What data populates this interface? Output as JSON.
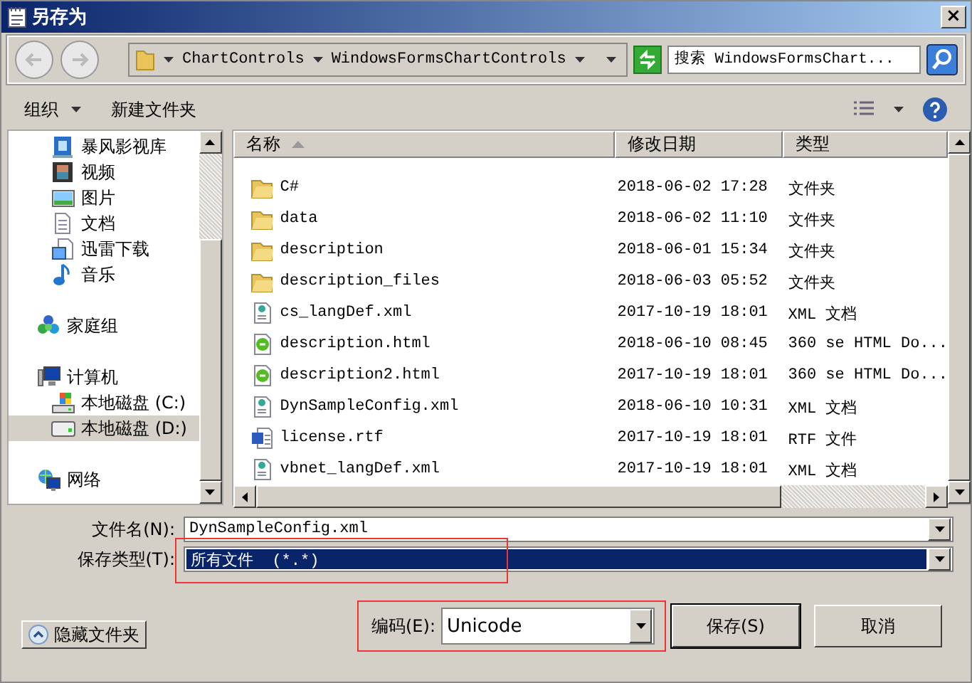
{
  "window": {
    "title": "另存为",
    "close": "×"
  },
  "address": {
    "crumbs": [
      "ChartControls",
      "WindowsFormsChartControls"
    ],
    "search_placeholder": "搜索 WindowsFormsChart..."
  },
  "toolbar": {
    "organize": "组织",
    "new_folder": "新建文件夹"
  },
  "sidebar": {
    "library_items": [
      {
        "kind": "library",
        "label": "暴风影视库",
        "selected": false
      },
      {
        "kind": "video",
        "label": "视频",
        "selected": false
      },
      {
        "kind": "picture",
        "label": "图片",
        "selected": false
      },
      {
        "kind": "doc",
        "label": "文档",
        "selected": false
      },
      {
        "kind": "download",
        "label": "迅雷下载",
        "selected": false
      },
      {
        "kind": "music",
        "label": "音乐",
        "selected": false
      }
    ],
    "items": [
      {
        "kind": "homegroup",
        "label": "家庭组",
        "selected": false
      },
      {
        "kind": "computer",
        "label": "计算机",
        "selected": false,
        "children": [
          {
            "kind": "sysdrive",
            "label": "本地磁盘 (C:)",
            "selected": false
          },
          {
            "kind": "drive",
            "label": "本地磁盘 (D:)",
            "selected": true
          }
        ]
      },
      {
        "kind": "network",
        "label": "网络",
        "selected": false
      }
    ]
  },
  "table": {
    "columns": [
      "名称",
      "修改日期",
      "类型"
    ],
    "rows": [
      {
        "kind": "folder",
        "name": "C#",
        "date": "2018-06-02 17:28",
        "type": "文件夹"
      },
      {
        "kind": "folder",
        "name": "data",
        "date": "2018-06-02 11:10",
        "type": "文件夹"
      },
      {
        "kind": "folder",
        "name": "description",
        "date": "2018-06-01 15:34",
        "type": "文件夹"
      },
      {
        "kind": "folder",
        "name": "description_files",
        "date": "2018-06-03 05:52",
        "type": "文件夹"
      },
      {
        "kind": "xml",
        "name": "cs_langDef.xml",
        "date": "2017-10-19 18:01",
        "type": "XML 文档"
      },
      {
        "kind": "html",
        "name": "description.html",
        "date": "2018-06-10 08:45",
        "type": "360 se HTML Do..."
      },
      {
        "kind": "html",
        "name": "description2.html",
        "date": "2017-10-19 18:01",
        "type": "360 se HTML Do..."
      },
      {
        "kind": "xml",
        "name": "DynSampleConfig.xml",
        "date": "2018-06-10 10:31",
        "type": "XML 文档"
      },
      {
        "kind": "rtf",
        "name": "license.rtf",
        "date": "2017-10-19 18:01",
        "type": "RTF 文件"
      },
      {
        "kind": "xml",
        "name": "vbnet_langDef.xml",
        "date": "2017-10-19 18:01",
        "type": "XML 文档"
      }
    ]
  },
  "file_name": {
    "label": "文件名(N):",
    "value": "DynSampleConfig.xml"
  },
  "save_type": {
    "label": "保存类型(T):",
    "value": "所有文件  (*.*)",
    "highlighted": true
  },
  "hide_folders": "隐藏文件夹",
  "encoding": {
    "label": "编码(E):",
    "value": "Unicode",
    "highlighted": true
  },
  "buttons": [
    "保存(S)",
    "取消"
  ]
}
